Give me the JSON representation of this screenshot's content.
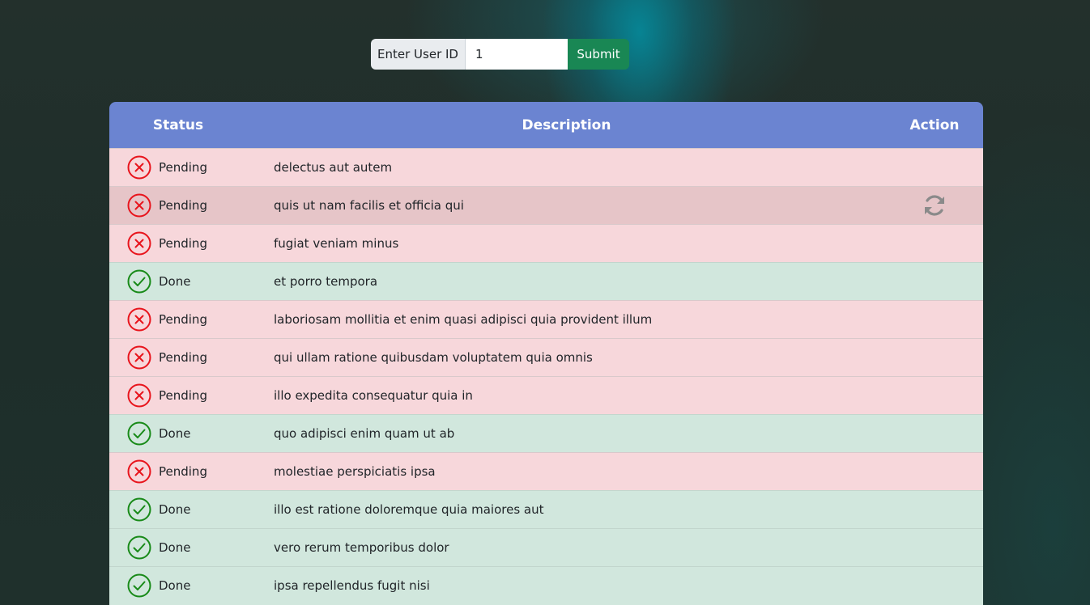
{
  "form": {
    "label": "Enter User ID",
    "input_value": "1",
    "submit_label": "Submit"
  },
  "table": {
    "headers": {
      "status": "Status",
      "description": "Description",
      "action": "Action"
    },
    "rows": [
      {
        "status": "Pending",
        "description": "delectus aut autem"
      },
      {
        "status": "Pending",
        "description": "quis ut nam facilis et officia qui"
      },
      {
        "status": "Pending",
        "description": "fugiat veniam minus"
      },
      {
        "status": "Done",
        "description": "et porro tempora"
      },
      {
        "status": "Pending",
        "description": "laboriosam mollitia et enim quasi adipisci quia provident illum"
      },
      {
        "status": "Pending",
        "description": "qui ullam ratione quibusdam voluptatem quia omnis"
      },
      {
        "status": "Pending",
        "description": "illo expedita consequatur quia in"
      },
      {
        "status": "Done",
        "description": "quo adipisci enim quam ut ab"
      },
      {
        "status": "Pending",
        "description": "molestiae perspiciatis ipsa"
      },
      {
        "status": "Done",
        "description": "illo est ratione doloremque quia maiores aut"
      },
      {
        "status": "Done",
        "description": "vero rerum temporibus dolor"
      },
      {
        "status": "Done",
        "description": "ipsa repellendus fugit nisi"
      }
    ]
  },
  "colors": {
    "header_bg": "#6b84d1",
    "pending_bg": "#f7d7db",
    "done_bg": "#d1e7dd",
    "pending_icon": "#e8141c",
    "done_icon": "#188a18",
    "submit_bg": "#198754"
  },
  "icons": {
    "pending": "x-circle-icon",
    "done": "check-circle-icon",
    "action": "refresh-icon"
  }
}
